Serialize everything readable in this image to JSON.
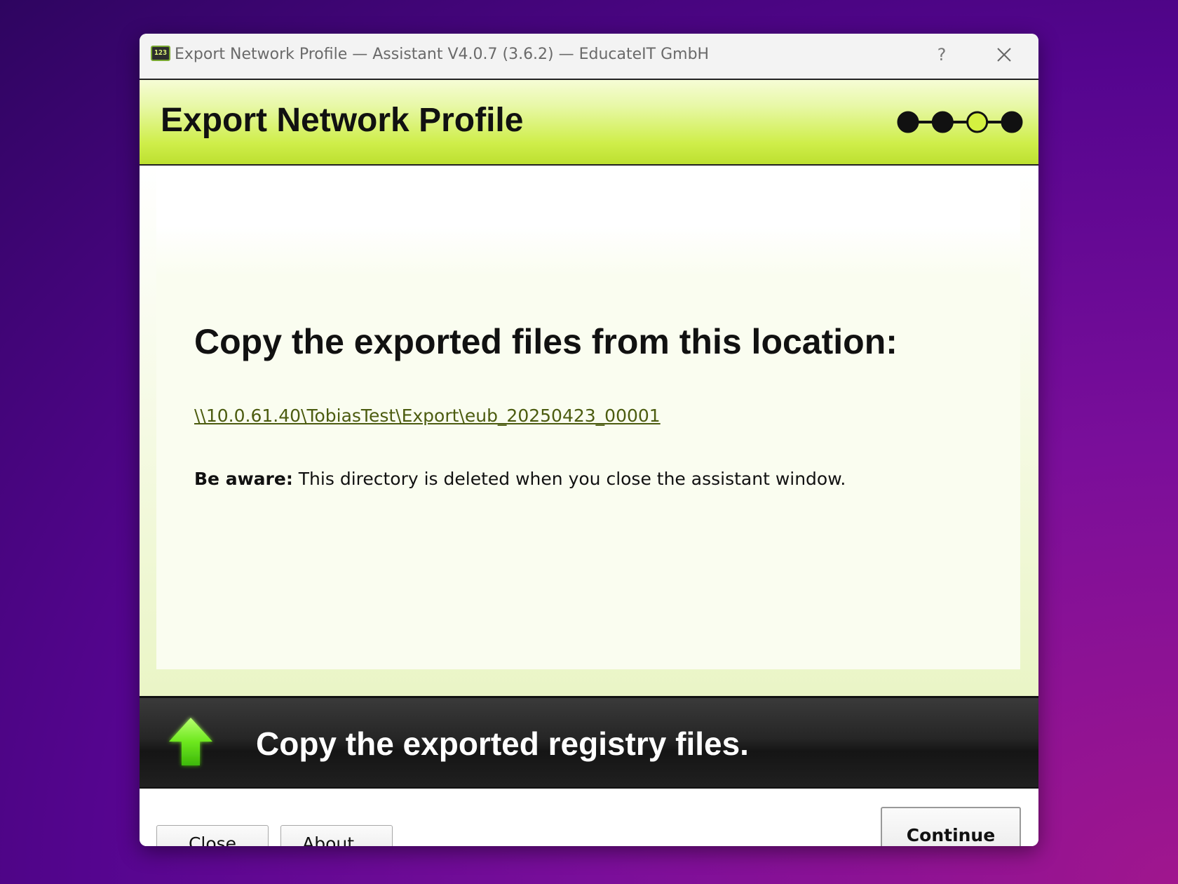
{
  "window": {
    "title": "Export Network Profile — Assistant V4.0.7 (3.6.2) — EducateIT GmbH",
    "app_icon_text": "123",
    "help_label": "?"
  },
  "header": {
    "title": "Export Network Profile",
    "steps": {
      "total": 4,
      "current": 3
    },
    "accent_color": "#d4f040"
  },
  "content": {
    "heading": "Copy the exported files from this location:",
    "path": "\\\\10.0.61.40\\TobiasTest\\Export\\eub_20250423_00001",
    "warning_label": "Be aware:",
    "warning_text": " This directory is deleted when you close the assistant window."
  },
  "banner": {
    "icon": "up-arrow-icon",
    "text": "Copy the exported registry files."
  },
  "footer": {
    "close_label": "Close",
    "about_label": "About...",
    "continue_label": "Continue"
  }
}
